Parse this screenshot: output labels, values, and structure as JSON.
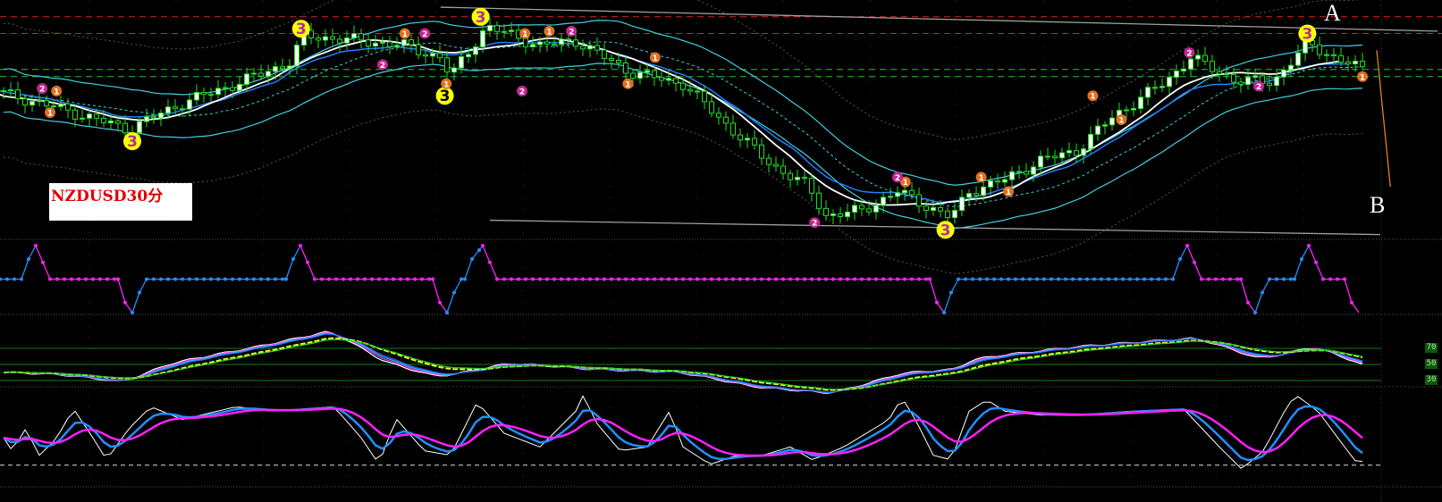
{
  "chart_data": [
    {
      "type": "candlestick",
      "title": "NZDUSD30分",
      "symbol_label": "NZDUSD30分",
      "annotations": {
        "point_a": "A",
        "point_b": "B"
      },
      "bar_spacing_note": "x in bar index",
      "price_path": [
        [
          0,
          61
        ],
        [
          7.5,
          55
        ],
        [
          17.5,
          46
        ],
        [
          25,
          57
        ],
        [
          32.5,
          65
        ],
        [
          40,
          74
        ],
        [
          42,
          85
        ],
        [
          50,
          83
        ],
        [
          56,
          81
        ],
        [
          61,
          76
        ],
        [
          62.5,
          68
        ],
        [
          67.5,
          89
        ],
        [
          75,
          81
        ],
        [
          80,
          83
        ],
        [
          87.5,
          70
        ],
        [
          95,
          65
        ],
        [
          102.5,
          44
        ],
        [
          107.5,
          31
        ],
        [
          112.5,
          22
        ],
        [
          115,
          10
        ],
        [
          120,
          12
        ],
        [
          125,
          20
        ],
        [
          132.5,
          9
        ],
        [
          135,
          20
        ],
        [
          140,
          25
        ],
        [
          145,
          33
        ],
        [
          150,
          37
        ],
        [
          155,
          51
        ],
        [
          162.5,
          66
        ],
        [
          166,
          76
        ],
        [
          172.5,
          66
        ],
        [
          177.5,
          66
        ],
        [
          182.5,
          82
        ],
        [
          186,
          76
        ],
        [
          190,
          71
        ]
      ],
      "ylim": [
        0,
        100
      ],
      "horizontal_lines": [
        {
          "value": 93,
          "color": "#e02020",
          "style": "dashed"
        },
        {
          "value": 86,
          "color": "#e02020",
          "style": "dashed"
        },
        {
          "value": 71,
          "color": "#30c030",
          "style": "dashed"
        },
        {
          "value": 68,
          "color": "#30c030",
          "style": "dashed"
        }
      ],
      "trendlines": [
        {
          "from": [
            61.6,
            97
          ],
          "to": [
            201,
            87
          ],
          "color": "#a0a0a0"
        },
        {
          "from": [
            68.5,
            8
          ],
          "to": [
            193,
            2
          ],
          "color": "#a0a0a0"
        },
        {
          "from": [
            192.5,
            79
          ],
          "to": [
            194.4,
            22
          ],
          "color": "#e08020"
        }
      ],
      "markers": [
        {
          "label": "3",
          "x": 18.5,
          "value": 41,
          "color": "#ffff00",
          "text_color": "#b0309a"
        },
        {
          "label": "3",
          "x": 42.1,
          "value": 88,
          "color": "#ffff00",
          "text_color": "#b0309a"
        },
        {
          "label": "3",
          "x": 62.2,
          "value": 60,
          "color": "#ffff00",
          "text_color": "#000000"
        },
        {
          "label": "3",
          "x": 67.2,
          "value": 93,
          "color": "#ffff00",
          "text_color": "#b0309a"
        },
        {
          "label": "3",
          "x": 132.2,
          "value": 4,
          "color": "#ffff00",
          "text_color": "#b0309a"
        },
        {
          "label": "3",
          "x": 182.8,
          "value": 86,
          "color": "#ffff00",
          "text_color": "#b0309a"
        },
        {
          "label": "1",
          "x": 7,
          "value": 53,
          "color": "#e07020"
        },
        {
          "label": "1",
          "x": 7.9,
          "value": 62,
          "color": "#e07020"
        },
        {
          "label": "1",
          "x": 56.6,
          "value": 86,
          "color": "#e07020"
        },
        {
          "label": "1",
          "x": 62.4,
          "value": 65,
          "color": "#e07020"
        },
        {
          "label": "1",
          "x": 73.4,
          "value": 86,
          "color": "#e07020"
        },
        {
          "label": "1",
          "x": 76.8,
          "value": 87,
          "color": "#e07020"
        },
        {
          "label": "1",
          "x": 87.8,
          "value": 65,
          "color": "#e07020"
        },
        {
          "label": "1",
          "x": 91.6,
          "value": 76,
          "color": "#e07020"
        },
        {
          "label": "1",
          "x": 126.6,
          "value": 24,
          "color": "#e07020"
        },
        {
          "label": "1",
          "x": 137.2,
          "value": 26,
          "color": "#e07020"
        },
        {
          "label": "1",
          "x": 141,
          "value": 20,
          "color": "#e07020"
        },
        {
          "label": "1",
          "x": 152.8,
          "value": 60,
          "color": "#e07020"
        },
        {
          "label": "1",
          "x": 156.8,
          "value": 50,
          "color": "#e07020"
        },
        {
          "label": "1",
          "x": 190.5,
          "value": 68,
          "color": "#e07020"
        },
        {
          "label": "2",
          "x": 5.9,
          "value": 63,
          "color": "#c02890"
        },
        {
          "label": "2",
          "x": 59.4,
          "value": 86,
          "color": "#c02890"
        },
        {
          "label": "2",
          "x": 53.5,
          "value": 73,
          "color": "#c02890"
        },
        {
          "label": "2",
          "x": 73,
          "value": 62,
          "color": "#c02890"
        },
        {
          "label": "2",
          "x": 79.9,
          "value": 87,
          "color": "#c02890"
        },
        {
          "label": "2",
          "x": 113.9,
          "value": 7,
          "color": "#c02890"
        },
        {
          "label": "2",
          "x": 125.5,
          "value": 26,
          "color": "#c02890"
        },
        {
          "label": "2",
          "x": 166.3,
          "value": 78,
          "color": "#c02890"
        },
        {
          "label": "2",
          "x": 176,
          "value": 64,
          "color": "#c02890"
        }
      ]
    },
    {
      "type": "line",
      "name": "step-signal",
      "ylim": [
        0,
        100
      ],
      "colors": {
        "up": "#2090ff",
        "down": "#ff20ff"
      },
      "points": [
        [
          0,
          50
        ],
        [
          3,
          50
        ],
        [
          4,
          80
        ],
        [
          5,
          100
        ],
        [
          6,
          75
        ],
        [
          7,
          50
        ],
        [
          16.5,
          50
        ],
        [
          17.5,
          15
        ],
        [
          18.5,
          0
        ],
        [
          19.5,
          30
        ],
        [
          20.5,
          50
        ],
        [
          40,
          50
        ],
        [
          41,
          80
        ],
        [
          42,
          100
        ],
        [
          43,
          75
        ],
        [
          44,
          50
        ],
        [
          60.5,
          50
        ],
        [
          61.5,
          15
        ],
        [
          62.5,
          0
        ],
        [
          63.5,
          30
        ],
        [
          64.5,
          50
        ],
        [
          65,
          50
        ],
        [
          66,
          80
        ],
        [
          67.5,
          100
        ],
        [
          68.5,
          75
        ],
        [
          69.5,
          50
        ],
        [
          130,
          50
        ],
        [
          131,
          15
        ],
        [
          132,
          0
        ],
        [
          133,
          30
        ],
        [
          134,
          50
        ],
        [
          164,
          50
        ],
        [
          165,
          80
        ],
        [
          166,
          100
        ],
        [
          167,
          75
        ],
        [
          168,
          50
        ],
        [
          173.5,
          50
        ],
        [
          174.5,
          15
        ],
        [
          175.5,
          0
        ],
        [
          176.5,
          30
        ],
        [
          177.5,
          50
        ],
        [
          181,
          50
        ],
        [
          182,
          80
        ],
        [
          183,
          100
        ],
        [
          184,
          75
        ],
        [
          185,
          50
        ],
        [
          188,
          50
        ],
        [
          189,
          15
        ],
        [
          190,
          0
        ]
      ]
    },
    {
      "type": "line",
      "name": "rsi-oscillator",
      "ylim": [
        0,
        100
      ],
      "levels": [
        "70",
        "50",
        "30"
      ],
      "level_values": [
        70,
        50,
        30
      ],
      "points": [
        [
          0,
          40
        ],
        [
          7.5,
          37
        ],
        [
          16,
          28
        ],
        [
          22.5,
          52
        ],
        [
          35,
          73
        ],
        [
          45,
          92
        ],
        [
          52.5,
          52
        ],
        [
          60,
          34
        ],
        [
          70,
          52
        ],
        [
          81,
          44
        ],
        [
          94,
          40
        ],
        [
          104,
          22
        ],
        [
          115,
          14
        ],
        [
          125,
          40
        ],
        [
          132.5,
          44
        ],
        [
          135,
          58
        ],
        [
          150,
          73
        ],
        [
          166,
          83
        ],
        [
          175,
          56
        ],
        [
          182.5,
          73
        ],
        [
          190,
          46
        ]
      ]
    },
    {
      "type": "line",
      "name": "stochastic-oscillator",
      "ylim": [
        0,
        100
      ],
      "dashed_level": 5,
      "points": [
        [
          0,
          41
        ],
        [
          1.2,
          24
        ],
        [
          3.1,
          53
        ],
        [
          5,
          18
        ],
        [
          7.5,
          41
        ],
        [
          8.8,
          65
        ],
        [
          10,
          76
        ],
        [
          12.5,
          41
        ],
        [
          14.4,
          12
        ],
        [
          17.5,
          53
        ],
        [
          20.6,
          82
        ],
        [
          25,
          65
        ],
        [
          32.5,
          82
        ],
        [
          37.5,
          76
        ],
        [
          46.2,
          82
        ],
        [
          50,
          41
        ],
        [
          52.5,
          6
        ],
        [
          53.8,
          41
        ],
        [
          55,
          65
        ],
        [
          58.8,
          24
        ],
        [
          62.5,
          18
        ],
        [
          65,
          65
        ],
        [
          66.2,
          88
        ],
        [
          70,
          47
        ],
        [
          75,
          29
        ],
        [
          80,
          76
        ],
        [
          81.2,
          100
        ],
        [
          82.5,
          65
        ],
        [
          86.2,
          24
        ],
        [
          90,
          29
        ],
        [
          93.1,
          76
        ],
        [
          95,
          29
        ],
        [
          98.8,
          6
        ],
        [
          102.5,
          18
        ],
        [
          106.2,
          18
        ],
        [
          110,
          29
        ],
        [
          113.1,
          12
        ],
        [
          117.5,
          29
        ],
        [
          123.8,
          65
        ],
        [
          125.6,
          94
        ],
        [
          127.5,
          65
        ],
        [
          130,
          18
        ],
        [
          132.5,
          12
        ],
        [
          135,
          76
        ],
        [
          137.5,
          91
        ],
        [
          140,
          76
        ],
        [
          145,
          71
        ],
        [
          150,
          71
        ],
        [
          157.5,
          76
        ],
        [
          165,
          79
        ],
        [
          170,
          29
        ],
        [
          173.1,
          0
        ],
        [
          176.2,
          24
        ],
        [
          178.8,
          71
        ],
        [
          180.6,
          98
        ],
        [
          183.8,
          76
        ],
        [
          187.5,
          29
        ],
        [
          189.4,
          6
        ],
        [
          191.2,
          18
        ]
      ]
    }
  ]
}
